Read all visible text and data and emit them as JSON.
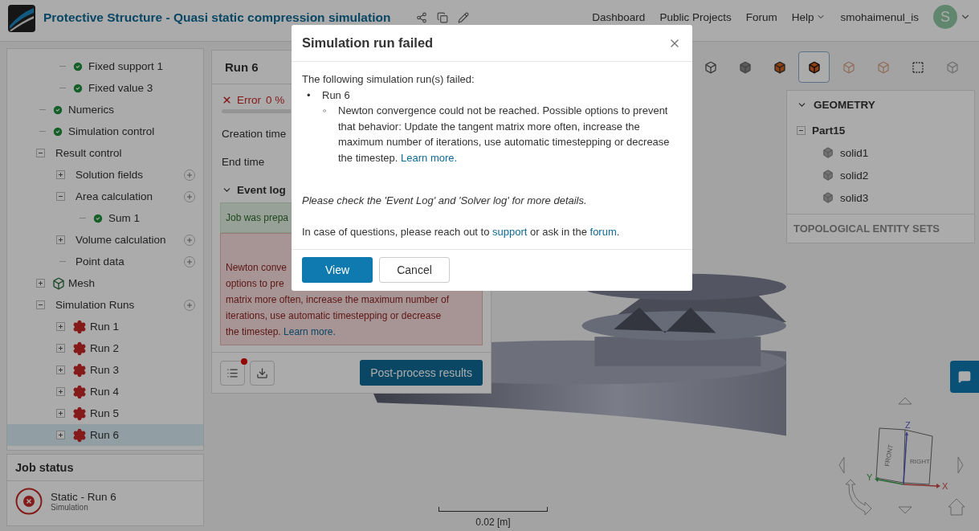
{
  "header": {
    "title": "Protective Structure - Quasi static compression simulation",
    "nav": [
      "Dashboard",
      "Public Projects",
      "Forum",
      "Help"
    ],
    "user": "smohaimenul_is",
    "avatar": "S"
  },
  "sidebar": {
    "clipped_items": [
      {
        "label": "Fixed support 1",
        "kind": "done"
      },
      {
        "label": "Fixed value 3",
        "kind": "done"
      }
    ],
    "items": [
      {
        "label": "Numerics",
        "kind": "done"
      },
      {
        "label": "Simulation control",
        "kind": "done"
      },
      {
        "label": "Result control",
        "expanded": true,
        "children": [
          {
            "label": "Solution fields",
            "expanded": false,
            "addable": true
          },
          {
            "label": "Area calculation",
            "expanded": true,
            "addable": true,
            "children": [
              {
                "label": "Sum 1",
                "kind": "done"
              }
            ]
          },
          {
            "label": "Volume calculation",
            "expanded": false,
            "addable": true
          },
          {
            "label": "Point data",
            "addable": true
          }
        ]
      },
      {
        "label": "Mesh",
        "kind": "mesh",
        "expanded": false
      },
      {
        "label": "Simulation Runs",
        "expanded": true,
        "addable": true,
        "children": [
          {
            "label": "Run 1",
            "kind": "failed",
            "expanded": false,
            "selected": false
          },
          {
            "label": "Run 2",
            "kind": "failed",
            "expanded": false,
            "selected": false
          },
          {
            "label": "Run 3",
            "kind": "failed",
            "expanded": false,
            "selected": false
          },
          {
            "label": "Run 4",
            "kind": "failed",
            "expanded": false,
            "selected": false
          },
          {
            "label": "Run 5",
            "kind": "failed",
            "expanded": false,
            "selected": false
          },
          {
            "label": "Run 6",
            "kind": "failed",
            "expanded": false,
            "selected": true
          }
        ]
      }
    ]
  },
  "job_status": {
    "title": "Job status",
    "job": "Static - Run 6",
    "type": "Simulation"
  },
  "run_panel": {
    "title": "Run 6",
    "status": "Error",
    "progress": "0 %",
    "level": 0,
    "fields": [
      "Creation time",
      "End time"
    ],
    "event_log": {
      "title": "Event log",
      "expanded": true,
      "entries": [
        {
          "kind": "success",
          "lines": [
            "Job was prepa"
          ]
        },
        {
          "kind": "error",
          "lines": [
            "Newton conve",
            "options to pre",
            "matrix more often, increase the maximum number of",
            "iterations, use automatic timestepping or decrease"
          ],
          "last": "the timestep.",
          "link": "Learn more."
        }
      ]
    },
    "unread": true,
    "action": "Post-process results"
  },
  "toolbar": [
    {
      "kind": "wire",
      "selected": false
    },
    {
      "kind": "solid",
      "selected": false
    },
    {
      "kind": "faces",
      "selected": false
    },
    {
      "kind": "face-edge",
      "selected": true
    },
    {
      "kind": "points",
      "selected": false
    },
    {
      "kind": "edges",
      "selected": false
    },
    {
      "kind": "box-select",
      "selected": false
    },
    {
      "kind": "mesh",
      "selected": false
    }
  ],
  "geometry": {
    "title": "GEOMETRY",
    "expanded": true,
    "part": {
      "label": "Part15",
      "expanded": true,
      "children": [
        "solid1",
        "solid2",
        "solid3"
      ]
    },
    "footer": "TOPOLOGICAL ENTITY SETS"
  },
  "scale": "0.02 [m]",
  "view_cube": {
    "front": "FRONT",
    "right": "RIGHT",
    "x": "X",
    "y": "Y",
    "z": "Z"
  },
  "dialog": {
    "title": "Simulation run failed",
    "intro": "The following simulation run(s) failed:",
    "runs": [
      {
        "marker": "•",
        "name": "Run 6",
        "messages": [
          {
            "marker": "◦",
            "text": "Newton convergence could not be reached. Possible options to prevent that behavior: Update the tangent matrix more often, increase the maximum number of iterations, use automatic timestepping or decrease the timestep.",
            "link": "Learn more."
          }
        ]
      }
    ],
    "note": "Please check the 'Event Log' and 'Solver log' for more details.",
    "contact": {
      "before": "In case of questions, please reach out to",
      "link1": "support",
      "middle": "or ask in the",
      "link2": "forum",
      "after": "."
    },
    "buttons": [
      {
        "label": "View",
        "kind": "primary"
      },
      {
        "label": "Cancel",
        "kind": "secondary"
      }
    ]
  }
}
